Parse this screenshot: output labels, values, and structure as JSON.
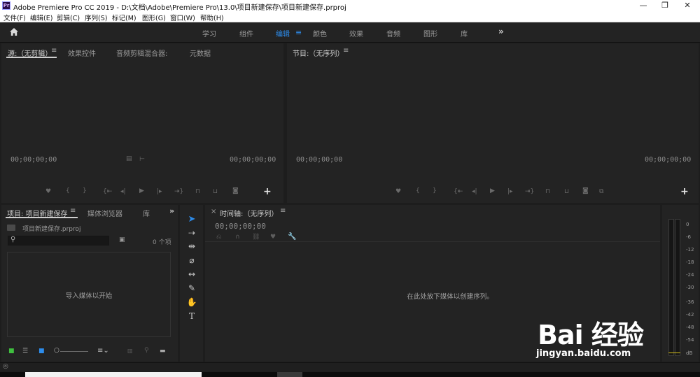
{
  "window": {
    "title": "Adobe Premiere Pro CC 2019 - D:\\文档\\Adobe\\Premiere Pro\\13.0\\项目新建保存\\项目新建保存.prproj",
    "app_icon": "Pr",
    "controls": [
      "—",
      "❐",
      "✕"
    ]
  },
  "menu": [
    "文件(F)",
    "编辑(E)",
    "剪辑(C)",
    "序列(S)",
    "标记(M)",
    "图形(G)",
    "窗口(W)",
    "帮助(H)"
  ],
  "workspaces": {
    "tabs": [
      "学习",
      "组件",
      "编辑",
      "颜色",
      "效果",
      "音频",
      "图形",
      "库"
    ],
    "active": "编辑",
    "more": "»"
  },
  "source_panel": {
    "tabs": [
      "源:（无剪辑）",
      "效果控件",
      "音频剪辑混合器:",
      "元数据"
    ],
    "tc_left": "00;00;00;00",
    "tc_right": "00;00;00;00",
    "add": "+"
  },
  "program_panel": {
    "title": "节目:（无序列）",
    "tc_left": "00;00;00;00",
    "tc_right": "00;00;00;00",
    "add": "+"
  },
  "project_panel": {
    "tabs": [
      "项目: 项目新建保存",
      "媒体浏览器",
      "库"
    ],
    "more": "»",
    "file": "项目新建保存.prproj",
    "search_placeholder": "",
    "item_count": "0 个项",
    "empty_hint": "导入媒体以开始"
  },
  "timeline_panel": {
    "close": "×",
    "title": "时间轴:（无序列）",
    "timecode": "00;00;00;00",
    "empty_hint": "在此处放下媒体以创建序列。"
  },
  "audio_meter": {
    "scale": [
      "0",
      "-6",
      "-12",
      "-18",
      "-24",
      "-30",
      "-36",
      "-42",
      "-48",
      "-54",
      "dB"
    ]
  },
  "watermark": {
    "logo": "Bai 经验",
    "url": "jingyan.baidu.com"
  },
  "colors": {
    "accent": "#2d8ceb",
    "panel_bg": "#232323",
    "app_bg": "#1d1d1d"
  }
}
